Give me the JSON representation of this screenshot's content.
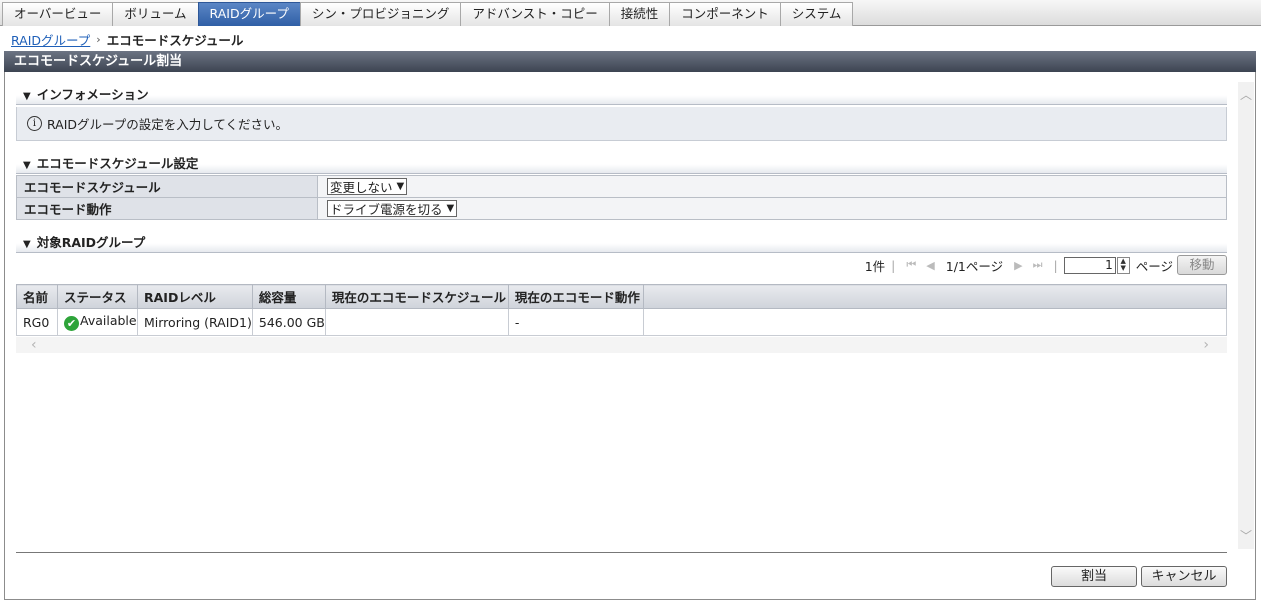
{
  "tabs": [
    {
      "label": "オーバービュー"
    },
    {
      "label": "ボリューム"
    },
    {
      "label": "RAIDグループ"
    },
    {
      "label": "シン・プロビジョニング"
    },
    {
      "label": "アドバンスト・コピー"
    },
    {
      "label": "接続性"
    },
    {
      "label": "コンポーネント"
    },
    {
      "label": "システム"
    }
  ],
  "active_tab": "RAIDグループ",
  "breadcrumb": {
    "parent": "RAIDグループ",
    "separator": "›",
    "current": "エコモードスケジュール"
  },
  "title": "エコモードスケジュール割当",
  "info_section": {
    "header": "インフォメーション",
    "message": "RAIDグループの設定を入力してください。"
  },
  "settings_section": {
    "header": "エコモードスケジュール設定",
    "rows": [
      {
        "label": "エコモードスケジュール",
        "value": "変更しない"
      },
      {
        "label": "エコモード動作",
        "value": "ドライブ電源を切る"
      }
    ]
  },
  "target_section": {
    "header": "対象RAIDグループ"
  },
  "pager": {
    "count": "1件",
    "page_info": "1/1ページ",
    "page_input": "1",
    "page_label": "ページ",
    "move_button": "移動"
  },
  "table": {
    "columns": [
      "名前",
      "ステータス",
      "RAIDレベル",
      "総容量",
      "現在のエコモードスケジュール",
      "現在のエコモード動作"
    ],
    "rows": [
      {
        "name": "RG0",
        "status": "Available",
        "raid_level": "Mirroring (RAID1)",
        "capacity": "546.00 GB",
        "schedule": "",
        "action": "-"
      }
    ]
  },
  "buttons": {
    "assign": "割当",
    "cancel": "キャンセル"
  },
  "colors": {
    "active_tab": "#3a69ae",
    "title_bar": "#4a5160",
    "status_ok": "#2ea43a",
    "link": "#1e5fb8"
  }
}
